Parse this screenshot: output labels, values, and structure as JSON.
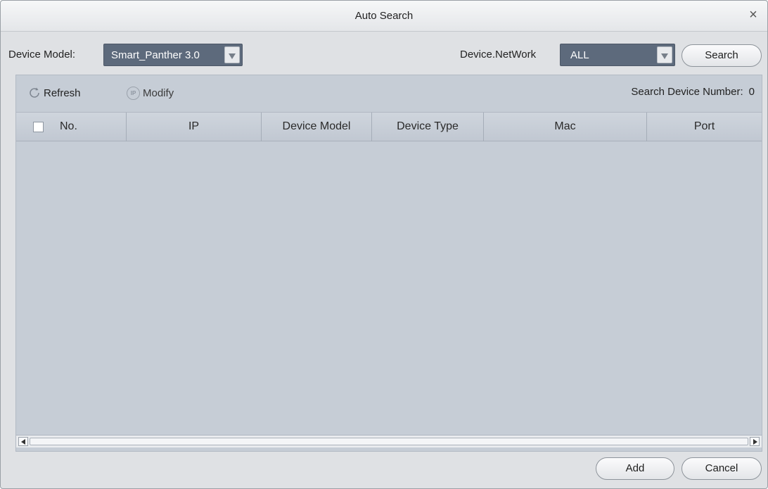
{
  "window": {
    "title": "Auto Search",
    "close_icon": "×"
  },
  "filters": {
    "device_model_label": "Device Model:",
    "device_model_value": "Smart_Panther 3.0",
    "network_label": "Device.NetWork",
    "network_value": "ALL",
    "search_label": "Search"
  },
  "toolbar": {
    "refresh_label": "Refresh",
    "modify_label": "Modify",
    "ip_icon_text": "IP",
    "count_label": "Search Device Number:",
    "count_value": "0"
  },
  "table": {
    "columns": [
      "No.",
      "IP",
      "Device Model",
      "Device Type",
      "Mac",
      "Port"
    ],
    "rows": []
  },
  "footer": {
    "add_label": "Add",
    "cancel_label": "Cancel"
  },
  "colors": {
    "combo_bg": "#5d6a7c",
    "panel_bg": "#c6cdd6",
    "dialog_bg": "#dfe1e4"
  }
}
